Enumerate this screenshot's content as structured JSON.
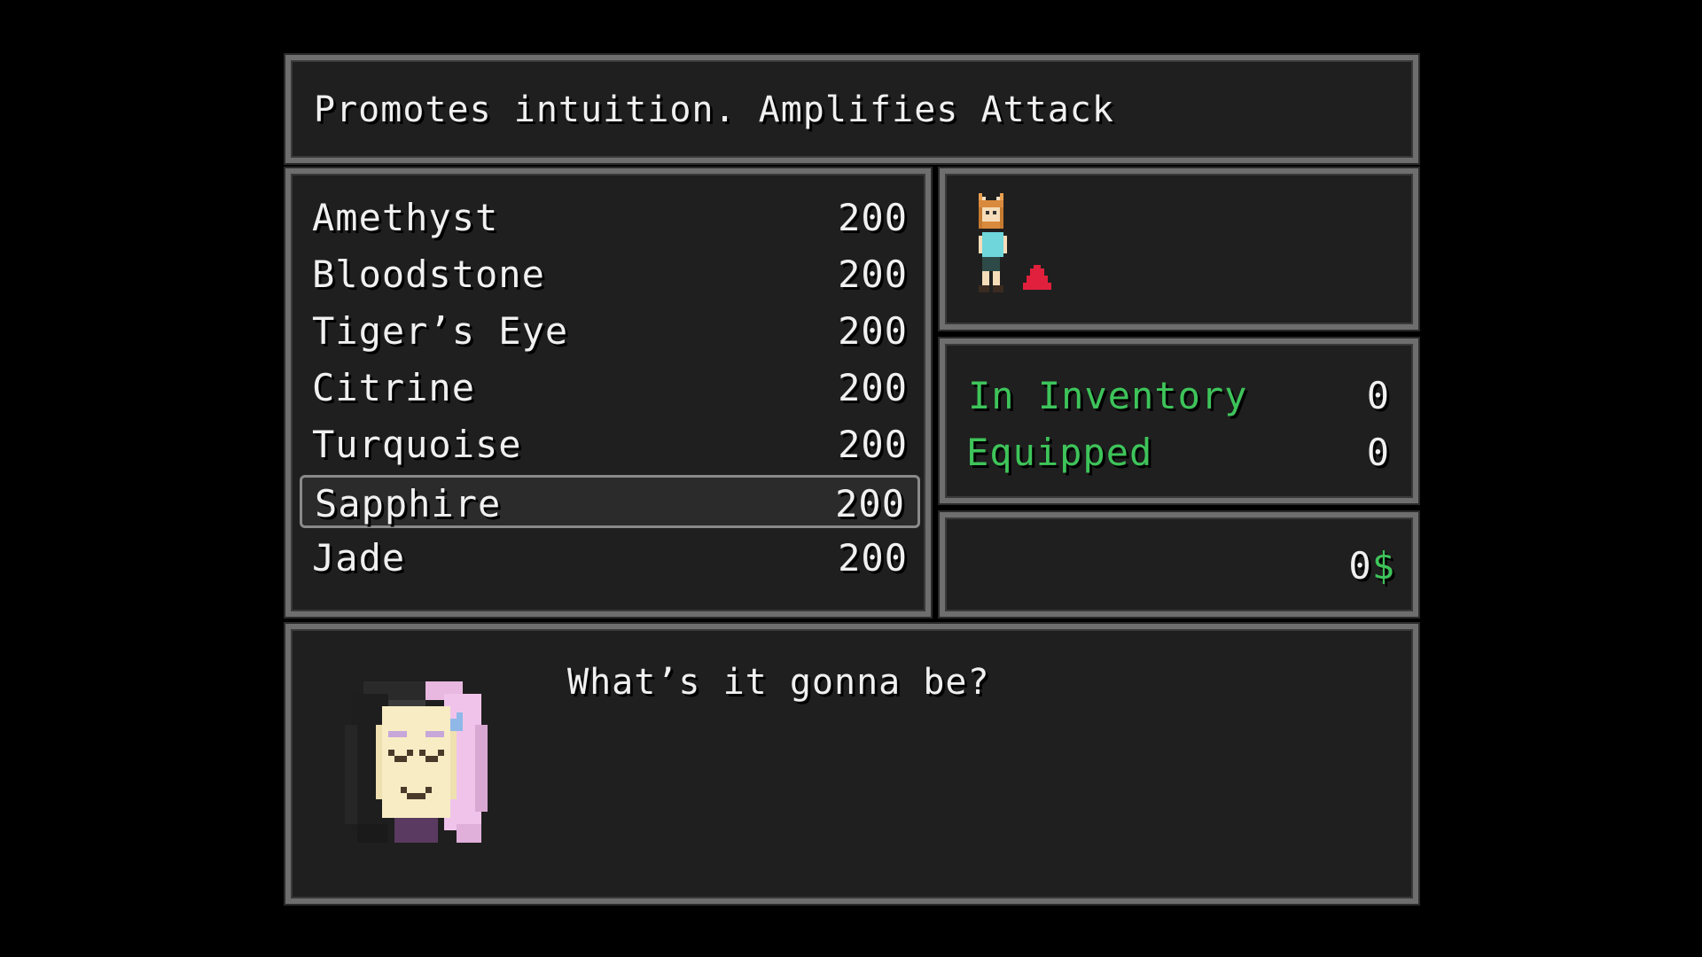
{
  "description": "Promotes intuition. Amplifies Attack",
  "shop_items": [
    {
      "name": "Amethyst",
      "price": "200"
    },
    {
      "name": "Bloodstone",
      "price": "200"
    },
    {
      "name": "Tiger’s Eye",
      "price": "200"
    },
    {
      "name": "Citrine",
      "price": "200"
    },
    {
      "name": "Turquoise",
      "price": "200"
    },
    {
      "name": "Sapphire",
      "price": "200",
      "selected": true
    },
    {
      "name": "Jade",
      "price": "200"
    }
  ],
  "stats": {
    "in_inventory_label": "In Inventory",
    "in_inventory_value": "0",
    "equipped_label": "Equipped",
    "equipped_value": "0"
  },
  "gold": {
    "amount": "0",
    "currency": "$"
  },
  "message": {
    "text": "What’s it gonna be?"
  },
  "actor": {
    "sprite": "fox-girl-sprite",
    "indicator": "red-up-arrow-icon"
  },
  "colors": {
    "window_bg": "#1f1f1f",
    "window_border": "#6e6e6e",
    "text": "#f0f0f0",
    "system_green": "#3ec45a",
    "stat_up_red": "#e0203c"
  }
}
